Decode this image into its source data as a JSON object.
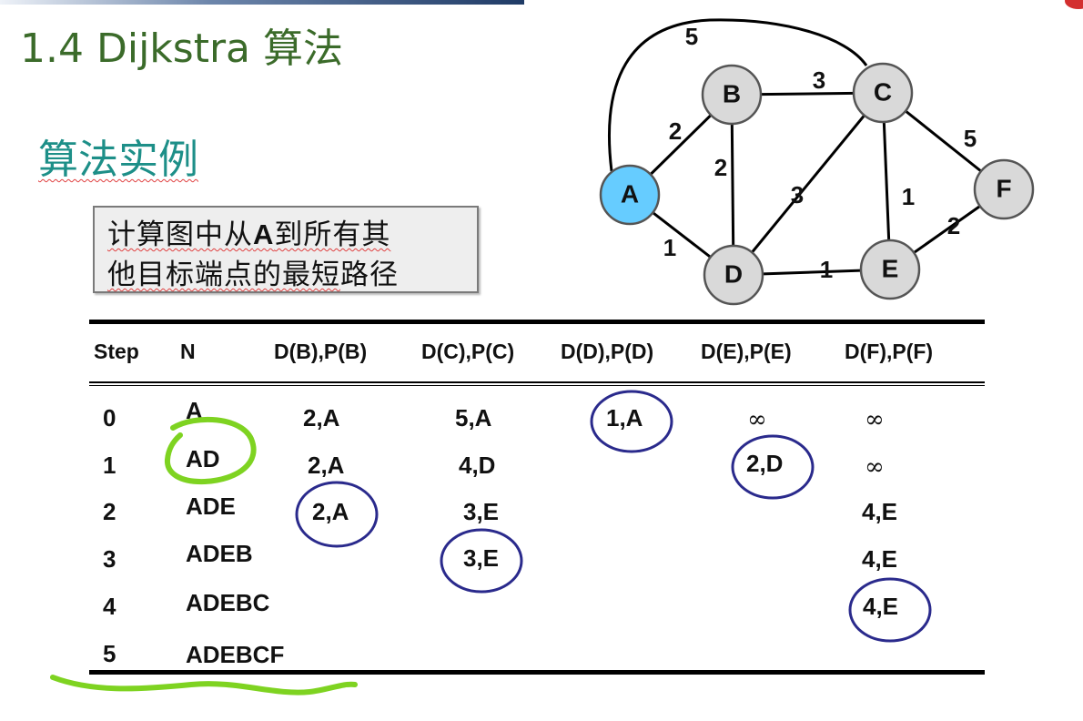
{
  "title": "1.4 Dijkstra 算法",
  "subtitle": "算法实例",
  "task": {
    "line1_prefix": "计算图中从",
    "line1_bold": "A",
    "line1_suffix": "到所有其",
    "line2_underlined": "他目标端点的最短",
    "line2_plain": "路径"
  },
  "graph": {
    "nodes": [
      {
        "id": "A",
        "label": "A",
        "color": "#66ccff"
      },
      {
        "id": "B",
        "label": "B",
        "color": "#d9d9d9"
      },
      {
        "id": "C",
        "label": "C",
        "color": "#d9d9d9"
      },
      {
        "id": "D",
        "label": "D",
        "color": "#d9d9d9"
      },
      {
        "id": "E",
        "label": "E",
        "color": "#d9d9d9"
      },
      {
        "id": "F",
        "label": "F",
        "color": "#d9d9d9"
      }
    ],
    "edges": [
      {
        "from": "A",
        "to": "B",
        "weight": "2"
      },
      {
        "from": "A",
        "to": "D",
        "weight": "1"
      },
      {
        "from": "A",
        "to": "C",
        "weight": "5"
      },
      {
        "from": "B",
        "to": "C",
        "weight": "3"
      },
      {
        "from": "B",
        "to": "D",
        "weight": "2"
      },
      {
        "from": "C",
        "to": "D",
        "weight": "3"
      },
      {
        "from": "C",
        "to": "E",
        "weight": "1"
      },
      {
        "from": "C",
        "to": "F",
        "weight": "5"
      },
      {
        "from": "D",
        "to": "E",
        "weight": "1"
      },
      {
        "from": "E",
        "to": "F",
        "weight": "2"
      }
    ]
  },
  "table": {
    "headers": [
      "Step",
      "N",
      "D(B),P(B)",
      "D(C),P(C)",
      "D(D),P(D)",
      "D(E),P(E)",
      "D(F),P(F)"
    ],
    "rows": [
      {
        "step": "0",
        "n": "A",
        "db": "2,A",
        "dc": "5,A",
        "dd": "1,A",
        "de": "∞",
        "df": "∞"
      },
      {
        "step": "1",
        "n": "AD",
        "db": "2,A",
        "dc": "4,D",
        "dd": "",
        "de": "2,D",
        "df": "∞"
      },
      {
        "step": "2",
        "n": "ADE",
        "db": "2,A",
        "dc": "3,E",
        "dd": "",
        "de": "",
        "df": "4,E"
      },
      {
        "step": "3",
        "n": "ADEB",
        "db": "",
        "dc": "3,E",
        "dd": "",
        "de": "",
        "df": "4,E"
      },
      {
        "step": "4",
        "n": "ADEBC",
        "db": "",
        "dc": "",
        "dd": "",
        "de": "",
        "df": "4,E"
      },
      {
        "step": "5",
        "n": "ADEBCF",
        "db": "",
        "dc": "",
        "dd": "",
        "de": "",
        "df": ""
      }
    ]
  },
  "colors": {
    "title": "#3b6b2a",
    "subtitle": "#1d8f88",
    "circle_annotation": "#2a2a8c",
    "green_annotation": "#7ed321"
  }
}
